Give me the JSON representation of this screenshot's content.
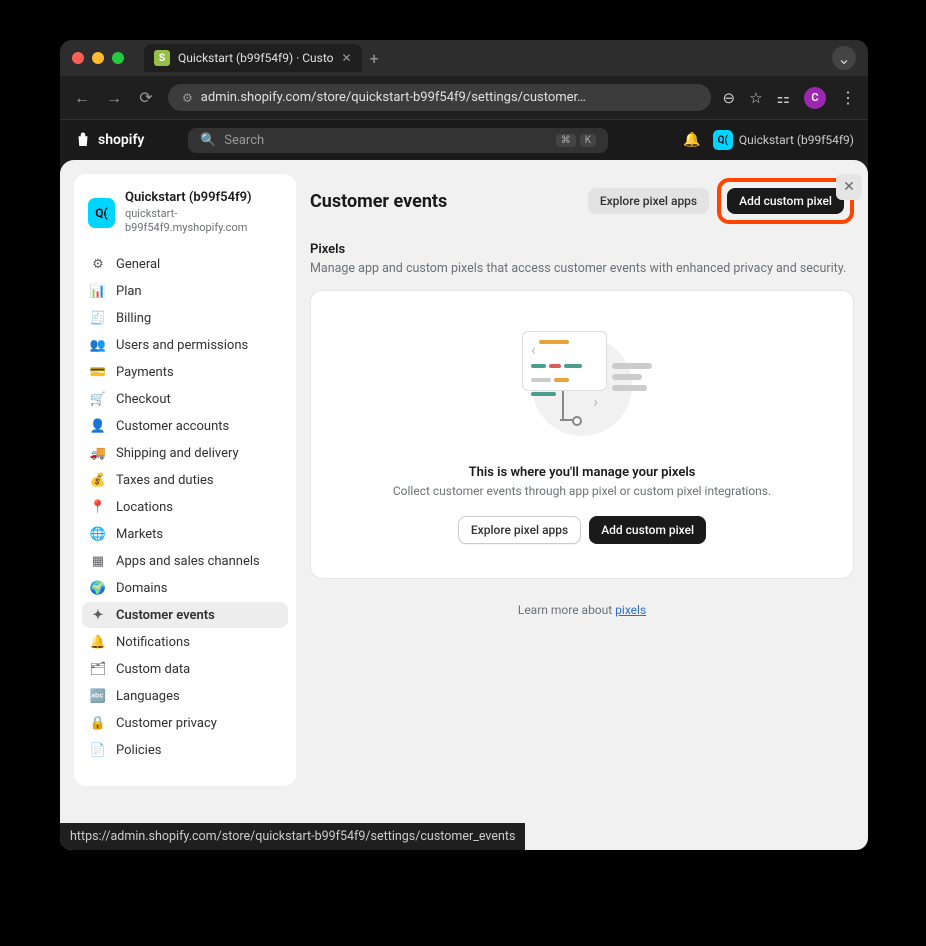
{
  "browser": {
    "tab_title": "Quickstart (b99f54f9) · Custo",
    "url": "admin.shopify.com/store/quickstart-b99f54f9/settings/customer…",
    "avatar_letter": "C",
    "status_url": "https://admin.shopify.com/store/quickstart-b99f54f9/settings/customer_events"
  },
  "header": {
    "brand": "shopify",
    "search_placeholder": "Search",
    "kbd1": "⌘",
    "kbd2": "K",
    "store_badge_text": "Q(",
    "store_label": "Quickstart (b99f54f9)"
  },
  "sidebar": {
    "store_icon": "Q(",
    "store_name": "Quickstart (b99f54f9)",
    "store_url": "quickstart-b99f54f9.myshopify.com",
    "items": [
      {
        "label": "General",
        "icon": "⚙"
      },
      {
        "label": "Plan",
        "icon": "📊"
      },
      {
        "label": "Billing",
        "icon": "🧾"
      },
      {
        "label": "Users and permissions",
        "icon": "👥"
      },
      {
        "label": "Payments",
        "icon": "💳"
      },
      {
        "label": "Checkout",
        "icon": "🛒"
      },
      {
        "label": "Customer accounts",
        "icon": "👤"
      },
      {
        "label": "Shipping and delivery",
        "icon": "🚚"
      },
      {
        "label": "Taxes and duties",
        "icon": "💰"
      },
      {
        "label": "Locations",
        "icon": "📍"
      },
      {
        "label": "Markets",
        "icon": "🌐"
      },
      {
        "label": "Apps and sales channels",
        "icon": "▦"
      },
      {
        "label": "Domains",
        "icon": "🌍"
      },
      {
        "label": "Customer events",
        "icon": "✦"
      },
      {
        "label": "Notifications",
        "icon": "🔔"
      },
      {
        "label": "Custom data",
        "icon": "🗂"
      },
      {
        "label": "Languages",
        "icon": "🔤"
      },
      {
        "label": "Customer privacy",
        "icon": "🔒"
      },
      {
        "label": "Policies",
        "icon": "📄"
      }
    ]
  },
  "main": {
    "title": "Customer events",
    "explore_btn": "Explore pixel apps",
    "add_btn": "Add custom pixel",
    "section_title": "Pixels",
    "section_desc": "Manage app and custom pixels that access customer events with enhanced privacy and security.",
    "empty_title": "This is where you'll manage your pixels",
    "empty_desc": "Collect customer events through app pixel or custom pixel integrations.",
    "empty_explore": "Explore pixel apps",
    "empty_add": "Add custom pixel",
    "learn_prefix": "Learn more about ",
    "learn_link": "pixels"
  }
}
